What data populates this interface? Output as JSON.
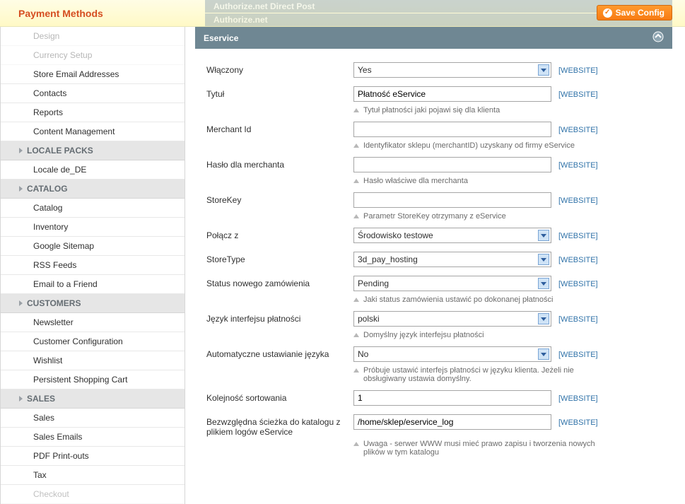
{
  "header": {
    "page_title": "Payment Methods",
    "save_button": "Save Config"
  },
  "accordions": {
    "authorize_direct": "Authorize.net Direct Post",
    "authorize": "Authorize.net",
    "eservice": "Eservice"
  },
  "sidebar": {
    "group0": {
      "items": [
        "Design",
        "Currency Setup",
        "Store Email Addresses",
        "Contacts",
        "Reports",
        "Content Management"
      ]
    },
    "locale": {
      "header": "LOCALE PACKS",
      "items": [
        "Locale de_DE"
      ]
    },
    "catalog": {
      "header": "CATALOG",
      "items": [
        "Catalog",
        "Inventory",
        "Google Sitemap",
        "RSS Feeds",
        "Email to a Friend"
      ]
    },
    "customers": {
      "header": "CUSTOMERS",
      "items": [
        "Newsletter",
        "Customer Configuration",
        "Wishlist",
        "Persistent Shopping Cart"
      ]
    },
    "sales": {
      "header": "SALES",
      "items": [
        "Sales",
        "Sales Emails",
        "PDF Print-outs",
        "Tax",
        "Checkout"
      ]
    }
  },
  "scope_label": "[WEBSITE]",
  "form": {
    "enabled": {
      "label": "Włączony",
      "value": "Yes"
    },
    "title": {
      "label": "Tytuł",
      "value": "Płatność eService",
      "hint": "Tytuł płatności jaki pojawi się dla klienta"
    },
    "merchant": {
      "label": "Merchant Id",
      "value": "",
      "hint": "Identyfikator sklepu (merchantID) uzyskany od firmy eService"
    },
    "password": {
      "label": "Hasło dla merchanta",
      "value": "",
      "hint": "Hasło właściwe dla merchanta"
    },
    "storekey": {
      "label": "StoreKey",
      "value": "",
      "hint": "Parametr StoreKey otrzymany z eService"
    },
    "connect": {
      "label": "Połącz z",
      "value": "Środowisko testowe"
    },
    "storetype": {
      "label": "StoreType",
      "value": "3d_pay_hosting"
    },
    "orderstat": {
      "label": "Status nowego zamówienia",
      "value": "Pending",
      "hint": "Jaki status zamówienia ustawić po dokonanej płatności"
    },
    "lang": {
      "label": "Język interfejsu płatności",
      "value": "polski",
      "hint": "Domyślny język interfejsu płatności"
    },
    "autolang": {
      "label": "Automatyczne ustawianie języka",
      "value": "No",
      "hint": "Próbuje ustawić interfejs płatności w języku klienta. Jeżeli nie obsługiwany ustawia domyślny."
    },
    "sort": {
      "label": "Kolejność sortowania",
      "value": "1"
    },
    "logpath": {
      "label": "Bezwzględna ścieżka do katalogu z plikiem logów eService",
      "value": "/home/sklep/eservice_log",
      "hint": "Uwaga - serwer WWW musi mieć prawo zapisu i tworzenia nowych plików w tym katalogu"
    }
  }
}
